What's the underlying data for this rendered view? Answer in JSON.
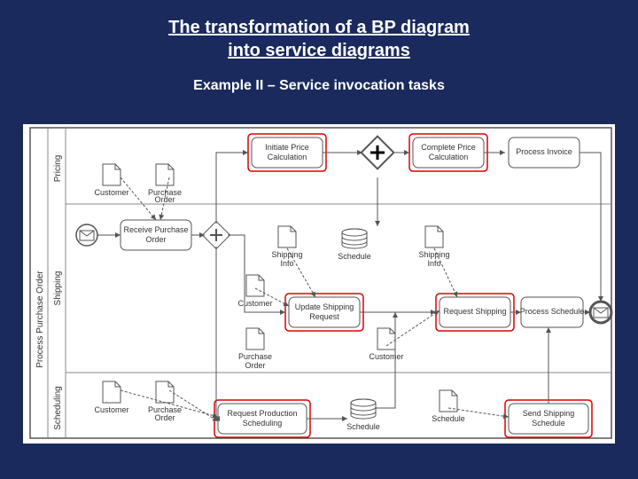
{
  "title_line1": "The transformation of a BP diagram",
  "title_line2": "into service diagrams",
  "subtitle": "Example II – Service invocation tasks",
  "pool_label": "Process Purchase Order",
  "lanes": {
    "pricing": "Pricing",
    "shipping": "Shipping",
    "scheduling": "Scheduling"
  },
  "tasks": {
    "initiate_price": "Initiate Price Calculation",
    "complete_price": "Complete Price Calculation",
    "process_invoice": "Process Invoice",
    "receive_po": "Receive Purchase Order",
    "update_shipping": "Update Shipping Request",
    "request_shipping": "Request Shipping",
    "process_schedule": "Process Schedule",
    "request_prod_sched": "Request Production Scheduling",
    "send_ship_sched": "Send Shipping Schedule"
  },
  "data_objects": {
    "customer": "Customer",
    "purchase_order": "Purchase Order",
    "shipping_info": "Shipping Info",
    "schedule": "Schedule"
  },
  "highlighted_tasks": [
    "initiate_price",
    "complete_price",
    "update_shipping",
    "request_shipping",
    "request_prod_sched",
    "send_ship_sched"
  ]
}
